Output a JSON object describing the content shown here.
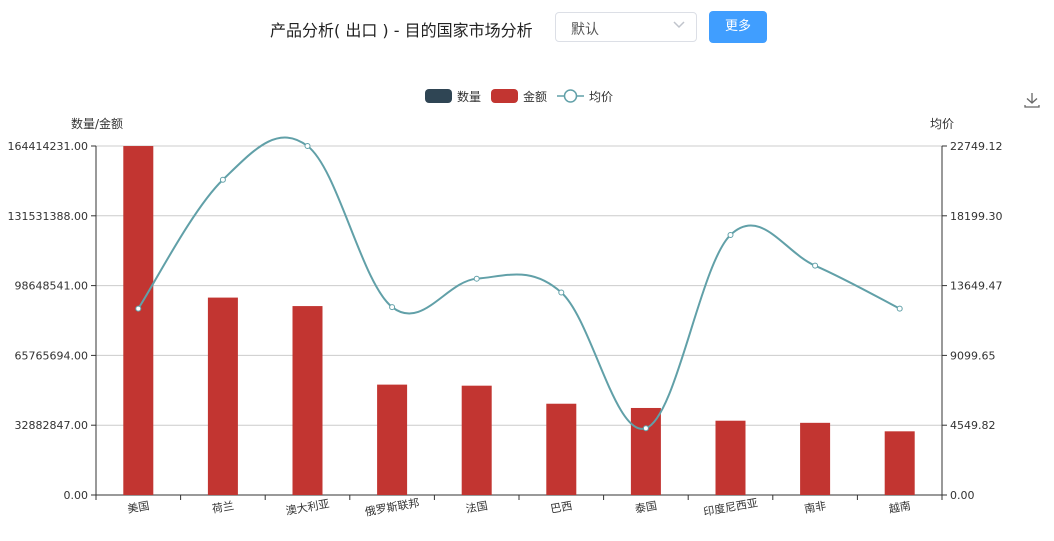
{
  "header": {
    "title": "产品分析( 出口 ) - 目的国家市场分析",
    "select_value": "默认",
    "more_label": "更多"
  },
  "toolbox": {
    "download_icon": "download-icon"
  },
  "colors": {
    "quantity": "#2f4554",
    "amount": "#c23531",
    "avg_price": "#61a0a8",
    "accent": "#409eff"
  },
  "chart_data": {
    "type": "bar",
    "categories": [
      "美国",
      "荷兰",
      "澳大利亚",
      "俄罗斯联邦",
      "法国",
      "巴西",
      "泰国",
      "印度尼西亚",
      "南非",
      "越南"
    ],
    "legend": [
      "数量",
      "金额",
      "均价"
    ],
    "y_left": {
      "name": "数量/金额",
      "min": 0,
      "max": 164414231,
      "ticks": [
        "0.00",
        "32882847.00",
        "65765694.00",
        "98648541.00",
        "131531388.00",
        "164414231.00"
      ]
    },
    "y_right": {
      "name": "均价",
      "min": 0,
      "max": 22749.12,
      "ticks": [
        "0.00",
        "4549.82",
        "9099.65",
        "13649.47",
        "18199.30",
        "22749.12"
      ]
    },
    "series": [
      {
        "name": "数量",
        "type": "bar",
        "axis": "left",
        "values": [
          0,
          0,
          0,
          0,
          0,
          0,
          0,
          0,
          0,
          0
        ]
      },
      {
        "name": "金额",
        "type": "bar",
        "axis": "left",
        "values": [
          164400000,
          93000000,
          89000000,
          52000000,
          51500000,
          43000000,
          41000000,
          35000000,
          34000000,
          30000000
        ]
      },
      {
        "name": "均价",
        "type": "line",
        "axis": "right",
        "smooth": true,
        "values": [
          12150,
          20550,
          22749.12,
          12250,
          14100,
          13200,
          4350,
          16950,
          14950,
          12150
        ]
      }
    ],
    "grid": "horizontal",
    "legend_position": "top-center"
  }
}
